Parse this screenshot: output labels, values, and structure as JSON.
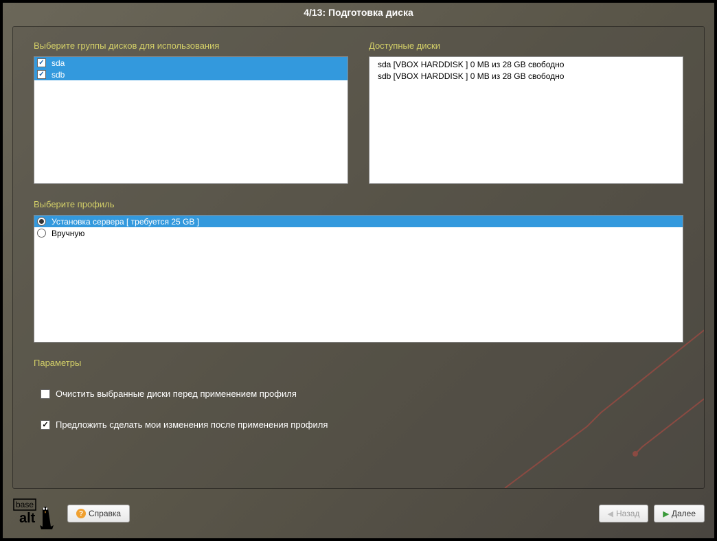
{
  "title": "4/13: Подготовка диска",
  "sections": {
    "disk_groups": "Выберите группы дисков для использования",
    "available_disks": "Доступные диски",
    "profile": "Выберите профиль",
    "params": "Параметры"
  },
  "disk_groups": [
    {
      "name": "sda",
      "checked": true
    },
    {
      "name": "sdb",
      "checked": true
    }
  ],
  "available_disks": [
    "sda [VBOX HARDDISK   ]  0 MB из 28 GB свободно",
    "sdb [VBOX HARDDISK   ]  0 MB из 28 GB свободно"
  ],
  "profiles": [
    {
      "label": "Установка сервера [ требуется 25 GB ]",
      "selected": true
    },
    {
      "label": "Вручную",
      "selected": false
    }
  ],
  "params_options": {
    "clear_disks": {
      "label": "Очистить выбранные диски перед применением профиля",
      "checked": false
    },
    "propose_changes": {
      "label": "Предложить сделать мои изменения после применения профиля",
      "checked": true
    }
  },
  "buttons": {
    "help": "Справка",
    "back": "Назад",
    "next": "Далее"
  },
  "logo": {
    "top": "base",
    "bottom": "alt"
  }
}
